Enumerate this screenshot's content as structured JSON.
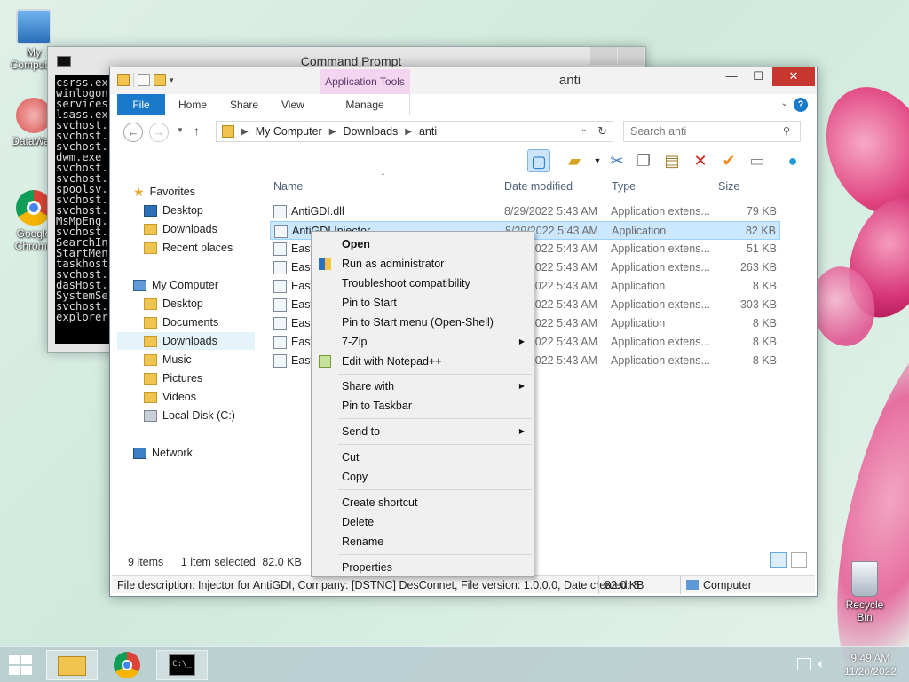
{
  "desktop": {
    "icons": [
      {
        "label": "My Computer"
      },
      {
        "label": "DataWag"
      },
      {
        "label": "Google Chrome"
      },
      {
        "label": "Recycle Bin"
      }
    ]
  },
  "cmd": {
    "title": "Command Prompt",
    "lines": [
      "csrss.ex",
      "winlogon",
      "services",
      "lsass.ex",
      "svchost.",
      "svchost.",
      "svchost.",
      "dwm.exe",
      "svchost.",
      "svchost.",
      "spoolsv.",
      "svchost.",
      "svchost.",
      "MsMpEng.",
      "svchost.",
      "SearchIn",
      "StartMen",
      "taskhost",
      "svchost.",
      "dasHost.",
      "SystemSe",
      "svchost.",
      "explorer"
    ]
  },
  "explorer": {
    "title": "anti",
    "context_tab": "Application Tools",
    "tabs": {
      "file": "File",
      "home": "Home",
      "share": "Share",
      "view": "View",
      "manage": "Manage"
    },
    "breadcrumb": [
      "My Computer",
      "Downloads",
      "anti"
    ],
    "search_placeholder": "Search anti",
    "columns": {
      "name": "Name",
      "date": "Date modified",
      "type": "Type",
      "size": "Size"
    },
    "nav": {
      "favorites": "Favorites",
      "desktop": "Desktop",
      "downloads": "Downloads",
      "recent": "Recent places",
      "my_computer": "My Computer",
      "desktop2": "Desktop",
      "documents": "Documents",
      "downloads2": "Downloads",
      "music": "Music",
      "pictures": "Pictures",
      "videos": "Videos",
      "local_disk": "Local Disk (C:)",
      "network": "Network"
    },
    "files": [
      {
        "name": "AntiGDI.dll",
        "date": "8/29/2022 5:43 AM",
        "type": "Application extens...",
        "size": "79 KB"
      },
      {
        "name": "AntiGDI Injector",
        "date": "8/29/2022 5:43 AM",
        "type": "Application",
        "size": "82 KB"
      },
      {
        "name": "Easy",
        "date": "8/29/2022 5:43 AM",
        "type": "Application extens...",
        "size": "51 KB"
      },
      {
        "name": "Easy",
        "date": "8/29/2022 5:43 AM",
        "type": "Application extens...",
        "size": "263 KB"
      },
      {
        "name": "Easy",
        "date": "8/29/2022 5:43 AM",
        "type": "Application",
        "size": "8 KB"
      },
      {
        "name": "Easy",
        "date": "8/29/2022 5:43 AM",
        "type": "Application extens...",
        "size": "303 KB"
      },
      {
        "name": "Easy",
        "date": "8/29/2022 5:43 AM",
        "type": "Application",
        "size": "8 KB"
      },
      {
        "name": "Easy",
        "date": "8/29/2022 5:43 AM",
        "type": "Application extens...",
        "size": "8 KB"
      },
      {
        "name": "Easy",
        "date": "8/29/2022 5:43 AM",
        "type": "Application extens...",
        "size": "8 KB"
      }
    ],
    "status": {
      "count": "9 items",
      "selected": "1 item selected",
      "sel_size": "82.0 KB"
    },
    "details": {
      "description": "File description: Injector for AntiGDI, Company: [DSTNC] DesConnet, File version: 1.0.0.0, Date created: 8",
      "size": "82.0 KB",
      "location": "Computer"
    }
  },
  "context_menu": {
    "open": "Open",
    "run_admin": "Run as administrator",
    "troubleshoot": "Troubleshoot compatibility",
    "pin_start": "Pin to Start",
    "pin_start_menu": "Pin to Start menu (Open-Shell)",
    "zip": "7-Zip",
    "notepad": "Edit with Notepad++",
    "share_with": "Share with",
    "pin_taskbar": "Pin to Taskbar",
    "send_to": "Send to",
    "cut": "Cut",
    "copy": "Copy",
    "create_shortcut": "Create shortcut",
    "delete": "Delete",
    "rename": "Rename",
    "properties": "Properties"
  },
  "taskbar": {
    "time": "9:49 AM",
    "date": "11/20/2022"
  },
  "colors": {
    "accent": "#1979ca",
    "selection": "#cce8ff",
    "close": "#c7372f"
  }
}
